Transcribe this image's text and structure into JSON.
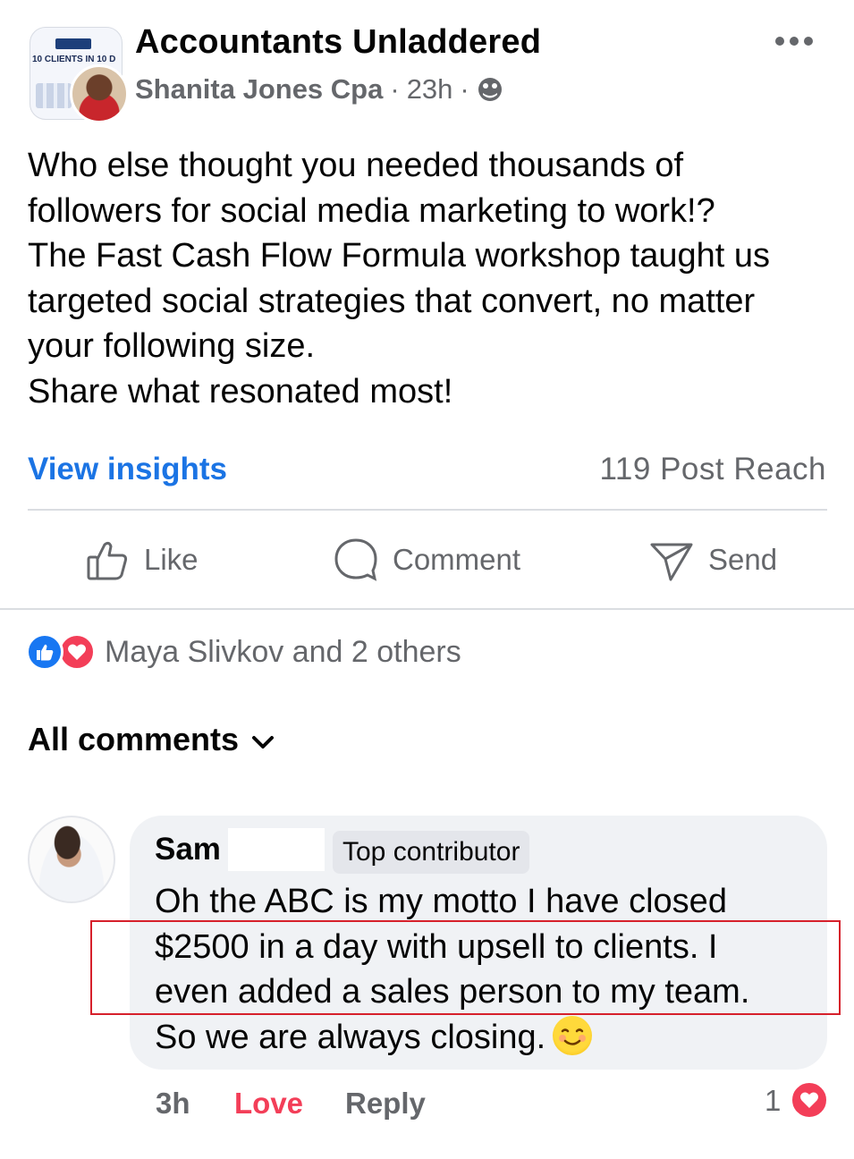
{
  "post": {
    "group_name": "Accountants Unladdered",
    "group_avatar_text": "10 CLIENTS IN 10 D",
    "author": "Shanita Jones Cpa",
    "time": "23h",
    "separator": "·",
    "audience_icon": "globe-icon",
    "more_icon": "more-horizontal-icon",
    "text": "Who else thought you needed thousands of\nfollowers for social media marketing to work!?\nThe Fast Cash Flow Formula workshop taught us\ntargeted social strategies that convert, no matter\nyour following size.\n Share what resonated most!"
  },
  "insights": {
    "link_label": "View insights",
    "reach": "119 Post Reach"
  },
  "actions": {
    "like": "Like",
    "comment": "Comment",
    "send": "Send"
  },
  "reactions": {
    "summary": "Maya Slivkov and 2 others",
    "icons": [
      "like-reaction-icon",
      "love-reaction-icon"
    ]
  },
  "comments_filter": {
    "label": "All comments",
    "icon": "chevron-down-icon"
  },
  "comment": {
    "name": "Sam",
    "badge": "Top contributor",
    "text": "Oh the ABC is my motto I have closed\n$2500 in a day with upsell to clients. I\neven added a sales person to my team.\nSo we are always closing.",
    "emoji": "smiling-face-emoji",
    "time": "3h",
    "love_label": "Love",
    "reply_label": "Reply",
    "reaction_count": "1"
  },
  "colors": {
    "link_blue": "#1b74e4",
    "love_red": "#f33e58",
    "secondary_text": "#65676b",
    "bubble_bg": "#f0f2f5",
    "highlight_border": "#d6202b"
  }
}
